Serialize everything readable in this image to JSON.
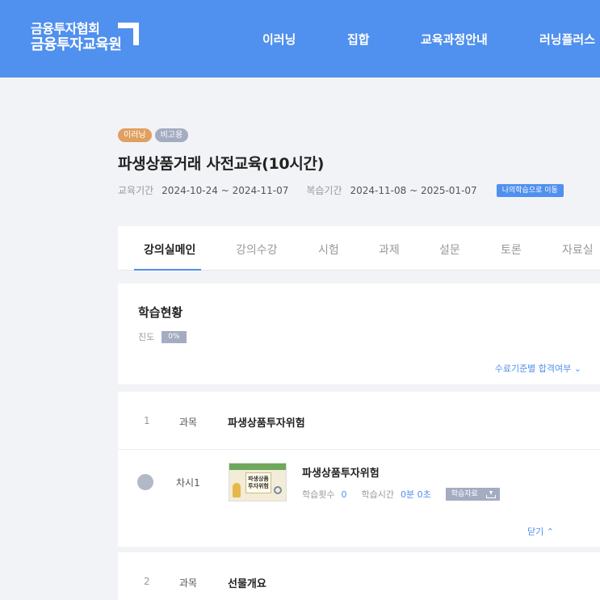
{
  "header": {
    "logo_line1": "금융투자협회",
    "logo_line2": "금융투자교육원",
    "nav": [
      "이러닝",
      "집합",
      "교육과정안내",
      "러닝플러스"
    ]
  },
  "course": {
    "badges": [
      "이러닝",
      "비고용"
    ],
    "title": "파생상품거래 사전교육(10시간)",
    "edu_period_label": "교육기간",
    "edu_period": "2024-10-24 ~ 2024-11-07",
    "review_period_label": "복습기간",
    "review_period": "2024-11-08 ~ 2025-01-07",
    "go_button": "나의학습으로 이동"
  },
  "tabs": [
    "강의실메인",
    "강의수강",
    "시험",
    "과제",
    "설문",
    "토론",
    "자료실"
  ],
  "status": {
    "title": "학습현황",
    "progress_label": "진도",
    "progress_value": "0%",
    "criteria_link": "수료기준별 합격여부 ⌄"
  },
  "subjects": [
    {
      "num": "1",
      "type": "과목",
      "title": "파생상품투자위험",
      "lessons": [
        {
          "round": "차시1",
          "thumb_text": "파생상품 투자위험",
          "title": "파생상품투자위험",
          "count_label": "학습횟수",
          "count": "0",
          "time_label": "학습시간",
          "time": "0분 0초",
          "material_label": "학습자료"
        }
      ],
      "close_label": "닫기 ⌃"
    },
    {
      "num": "2",
      "type": "과목",
      "title": "선물개요"
    }
  ]
}
